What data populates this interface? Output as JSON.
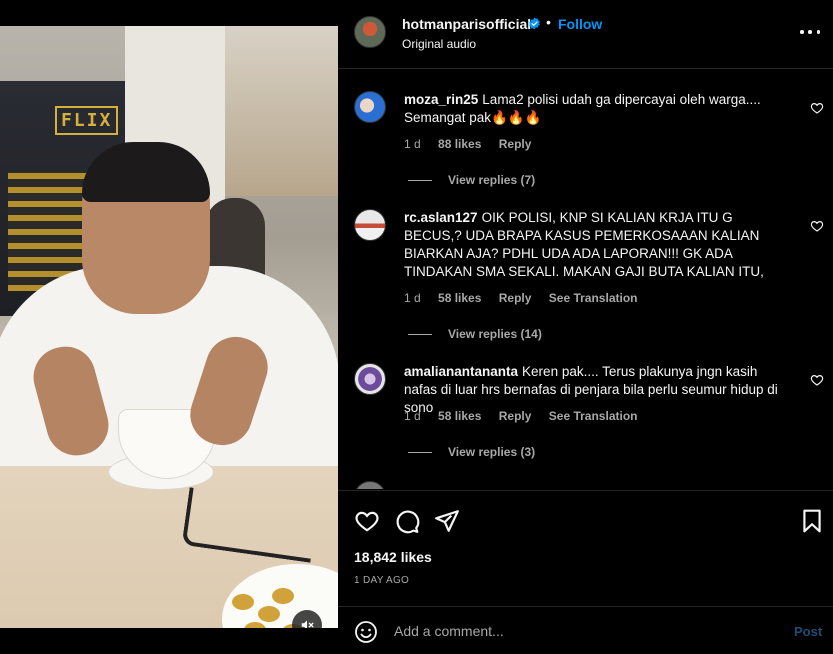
{
  "video": {
    "cinema_sign": "FLIX",
    "mute_icon": "speaker-muted-icon"
  },
  "header": {
    "username": "hotmanparisofficial",
    "separator": "•",
    "follow_label": "Follow",
    "subtitle": "Original audio",
    "more_icon": "more-options-icon"
  },
  "comments": [
    {
      "username": "moza_rin25",
      "text": "Lama2 polisi udah ga dipercayai oleh warga.... Semangat pak🔥🔥🔥",
      "time": "1 d",
      "likes": "88 likes",
      "reply_label": "Reply",
      "translation_label": "",
      "view_replies": "View replies (7)"
    },
    {
      "username": "rc.aslan127",
      "text": "OIK POLISI, KNP SI KALIAN KRJA ITU G BECUS,? UDA BRAPA KASUS PEMERKOSAAAN KALIAN BIARKAN AJA? PDHL UDA ADA LAPORAN!!! GK ADA TINDAKAN SMA SEKALI. MAKAN GAJI BUTA KALIAN ITU,",
      "time": "1 d",
      "likes": "58 likes",
      "reply_label": "Reply",
      "translation_label": "See Translation",
      "view_replies": "View replies (14)"
    },
    {
      "username": "amalianantananta",
      "text": "Keren pak.... Terus plakunya jngn kasih nafas di luar hrs bernafas di penjara bila perlu seumur hidup di sono",
      "time": "1 d",
      "likes": "58 likes",
      "reply_label": "Reply",
      "translation_label": "See Translation",
      "view_replies": "View replies (3)"
    }
  ],
  "actions": {
    "like_icon": "heart-icon",
    "comment_icon": "comment-icon",
    "share_icon": "share-icon",
    "save_icon": "bookmark-icon",
    "likes": "18,842 likes",
    "date": "1 DAY AGO"
  },
  "add_comment": {
    "emoji_icon": "emoji-icon",
    "placeholder": "Add a comment...",
    "post_label": "Post"
  },
  "colors": {
    "background": "#000000",
    "text": "#f5f5f5",
    "secondary_text": "#a8a8a8",
    "link": "#0095f6",
    "post_disabled": "#1f4d77"
  }
}
